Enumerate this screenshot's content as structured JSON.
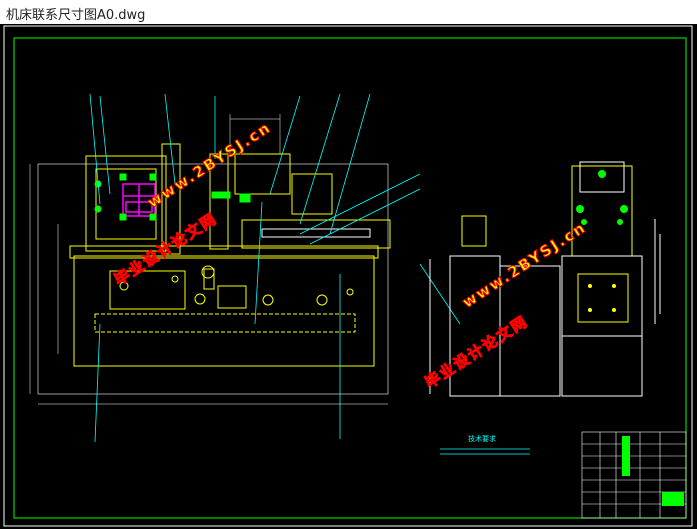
{
  "window": {
    "title": "机床联系尺寸图A0.dwg"
  },
  "colors": {
    "background": "#000000",
    "frame": "#FFFFFF",
    "outline": "#FFFF00",
    "leader": "#00FFFF",
    "green": "#00FF00",
    "magenta": "#FF00FF",
    "watermark_fill": "#FFFF00",
    "watermark_stroke": "#FF0000"
  },
  "watermarks": [
    {
      "cn": "毕业设计论文网",
      "url": "www.2BYSJ.cn"
    },
    {
      "cn": "毕业设计论文网",
      "url": "www.2BYSJ.cn"
    }
  ],
  "tech_requirements": {
    "heading": "技术要求"
  },
  "title_block": {
    "present": true
  }
}
